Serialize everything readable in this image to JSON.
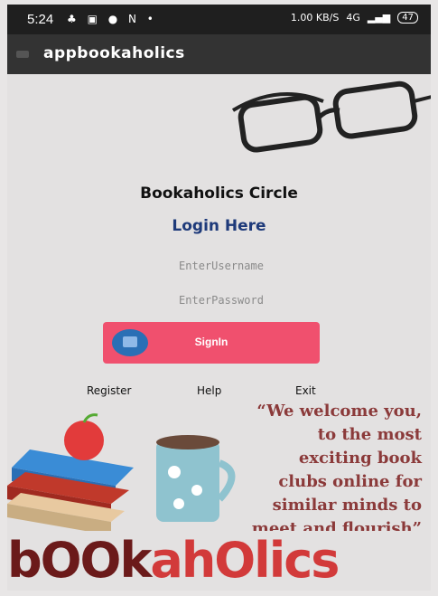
{
  "status_bar": {
    "time": "5:24",
    "speed": "1.00 KB/S",
    "network": "4G",
    "battery": "47"
  },
  "app_bar": {
    "title": "appbookaholics"
  },
  "login": {
    "title": "Bookaholics Circle",
    "subtitle": "Login Here",
    "username_placeholder": "EnterUsername",
    "password_placeholder": "EnterPassword",
    "signin_label": "SignIn"
  },
  "links": {
    "register": "Register",
    "help": "Help",
    "exit": "Exit"
  },
  "welcome_lines": [
    "“We welcome you,",
    "to the most",
    "exciting book",
    "clubs online for",
    "similar minds to",
    "meet and flourish”"
  ],
  "brand": {
    "part1": "bOOk",
    "part2": "ahOlics"
  },
  "colors": {
    "signin": "#f0506e",
    "subtitle": "#1e3a7a",
    "brand_dark": "#6b1a1a",
    "brand_light": "#d23a3a"
  }
}
